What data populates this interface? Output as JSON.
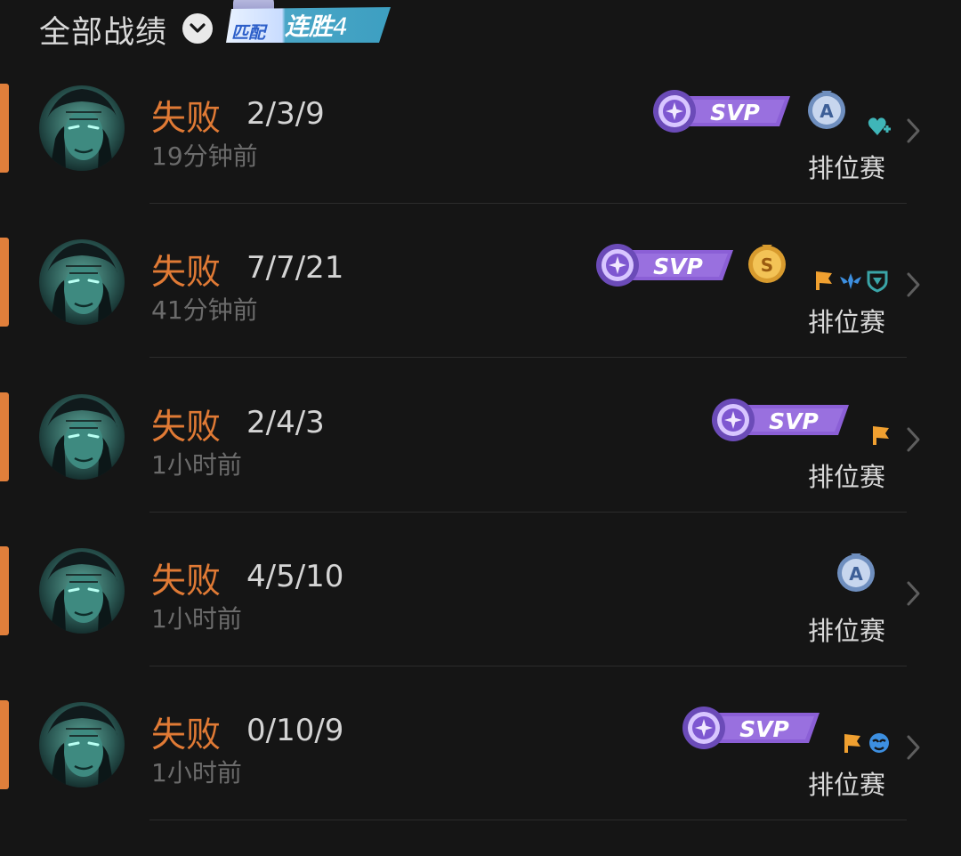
{
  "header": {
    "filter_label": "全部战绩",
    "streak_mode": "匹配",
    "streak_text": "连胜",
    "streak_count": "4"
  },
  "colors": {
    "loss": "#e07a35",
    "svp": "#8b5fd6",
    "background": "#151515"
  },
  "matches": [
    {
      "result": "失败",
      "kda": "2/3/9",
      "time": "19分钟前",
      "mode": "排位赛",
      "svp_label": "SVP",
      "medal_letter": "A",
      "tags": [
        "heart-plus-icon"
      ]
    },
    {
      "result": "失败",
      "kda": "7/7/21",
      "time": "41分钟前",
      "mode": "排位赛",
      "svp_label": "SVP",
      "medal_letter": "S",
      "tags": [
        "flag-icon",
        "wings-icon",
        "shield-icon"
      ]
    },
    {
      "result": "失败",
      "kda": "2/4/3",
      "time": "1小时前",
      "mode": "排位赛",
      "svp_label": "SVP",
      "medal_letter": "",
      "tags": [
        "flag-icon"
      ]
    },
    {
      "result": "失败",
      "kda": "4/5/10",
      "time": "1小时前",
      "mode": "排位赛",
      "svp_label": "",
      "medal_letter": "A",
      "tags": []
    },
    {
      "result": "失败",
      "kda": "0/10/9",
      "time": "1小时前",
      "mode": "排位赛",
      "svp_label": "SVP",
      "medal_letter": "",
      "tags": [
        "flag-icon",
        "mask-icon"
      ]
    }
  ]
}
